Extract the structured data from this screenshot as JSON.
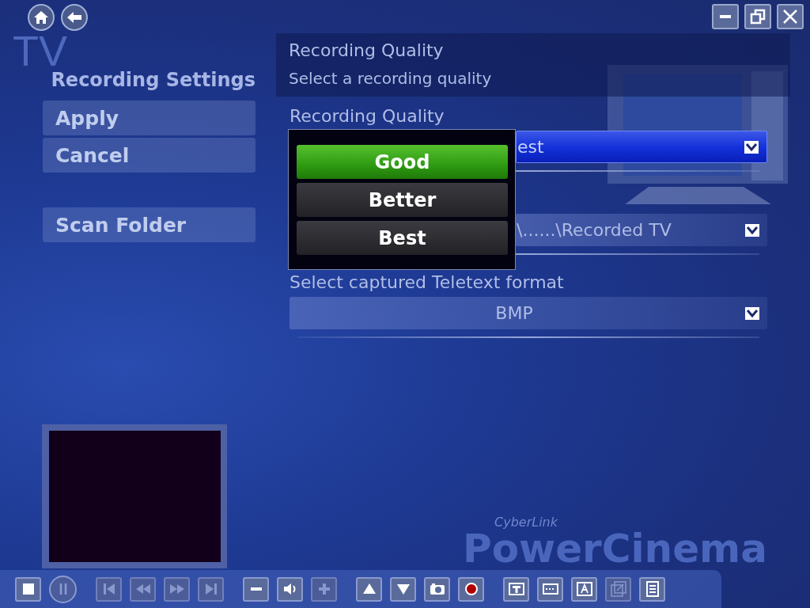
{
  "window": {
    "bg_title": "TV",
    "brand": [
      "CyberLink",
      "PowerCinema"
    ]
  },
  "sidebar": {
    "title": "Recording Settings",
    "buttons": [
      "Apply",
      "Cancel",
      "Scan Folder"
    ]
  },
  "header": {
    "title": "Recording Quality",
    "subtitle": "Select a recording quality"
  },
  "settings": [
    {
      "label": "Recording Quality",
      "value": "est",
      "focused": true
    },
    {
      "value": "\\......\\Recorded TV",
      "focused": false
    },
    {
      "label": "Select captured Teletext format",
      "value": "BMP",
      "focused": false
    }
  ],
  "popup": {
    "options": [
      {
        "label": "Good",
        "selected": true
      },
      {
        "label": "Better",
        "selected": false
      },
      {
        "label": "Best",
        "selected": false
      }
    ]
  },
  "toolbar": [
    {
      "kind": "stop",
      "disabled": false
    },
    {
      "kind": "pause",
      "disabled": false
    },
    {
      "kind": "previous",
      "disabled": true
    },
    {
      "kind": "rewind",
      "disabled": true
    },
    {
      "kind": "forward",
      "disabled": true
    },
    {
      "kind": "next",
      "disabled": true
    },
    {
      "kind": "volume-down",
      "disabled": false
    },
    {
      "kind": "volume",
      "disabled": false
    },
    {
      "kind": "volume-up",
      "disabled": true
    },
    {
      "kind": "channel-up",
      "disabled": false
    },
    {
      "kind": "channel-down",
      "disabled": false
    },
    {
      "kind": "snapshot",
      "disabled": false
    },
    {
      "kind": "record",
      "disabled": false
    },
    {
      "kind": "teletext",
      "disabled": false
    },
    {
      "kind": "subtitle",
      "disabled": false
    },
    {
      "kind": "caption",
      "disabled": false
    },
    {
      "kind": "zoom",
      "disabled": true
    },
    {
      "kind": "list",
      "disabled": false
    }
  ]
}
